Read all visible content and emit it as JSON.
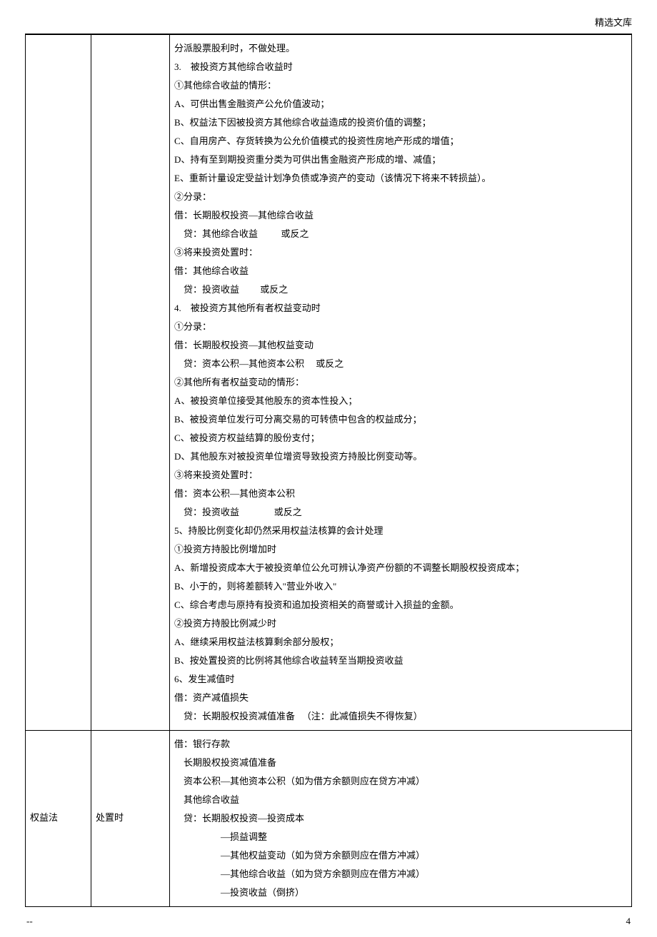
{
  "header": {
    "label": "精选文库"
  },
  "table": {
    "rows": [
      {
        "col0": "",
        "col1": "",
        "lines": [
          "分派股票股利时，不做处理。",
          "3.    被投资方其他综合收益时",
          "①其他综合收益的情形：",
          "A、可供出售金融资产公允价值波动；",
          "B、权益法下因被投资方其他综合收益造成的投资价值的调整；",
          "C、自用房产、存货转换为公允价值模式的投资性房地产形成的增值；",
          "D、持有至到期投资重分类为可供出售金融资产形成的增、减值；",
          "E、重新计量设定受益计划净负债或净资产的变动（该情况下将来不转损益）。",
          "②分录：",
          "借：长期股权投资—其他综合收益",
          "    贷：其他综合收益          或反之",
          "③将来投资处置时：",
          "借：其他综合收益",
          "    贷：投资收益         或反之",
          "4.    被投资方其他所有者权益变动时",
          "①分录：",
          "借：长期股权投资—其他权益变动",
          "    贷：资本公积—其他资本公积     或反之",
          "②其他所有者权益变动的情形：",
          "A、被投资单位接受其他股东的资本性投入；",
          "B、被投资单位发行可分离交易的可转债中包含的权益成分；",
          "C、被投资方权益结算的股份支付；",
          "D、其他股东对被投资单位增资导致投资方持股比例变动等。",
          "③将来投资处置时：",
          "借：资本公积—其他资本公积",
          "    贷：投资收益               或反之",
          "5、持股比例变化却仍然采用权益法核算的会计处理",
          "①投资方持股比例增加时",
          "A、新增投资成本大于被投资单位公允可辨认净资产份额的不调整长期股权投资成本；",
          "B、小于的，则将差额转入\"营业外收入\"",
          "C、综合考虑与原持有投资和追加投资相关的商誉或计入损益的金额。",
          "②投资方持股比例减少时",
          "A、继续采用权益法核算剩余部分股权；",
          "B、按处置投资的比例将其他综合收益转至当期投资收益",
          "6、发生减值时",
          "借：资产减值损失",
          "    贷：长期股权投资减值准备   （注：此减值损失不得恢复）"
        ]
      },
      {
        "col0": "权益法",
        "col1": "处置时",
        "lines": [
          "借：银行存款",
          "    长期股权投资减值准备",
          "    资本公积—其他资本公积（如为借方余额则应在贷方冲减）",
          "    其他综合收益",
          "    贷：长期股权投资—投资成本",
          "                    —损益调整",
          "                    —其他权益变动（如为贷方余额则应在借方冲减）",
          "                    —其他综合收益（如为贷方余额则应在借方冲减）",
          "                    —投资收益（倒挤）"
        ]
      }
    ]
  },
  "footer": {
    "left": "--",
    "right": "4"
  }
}
